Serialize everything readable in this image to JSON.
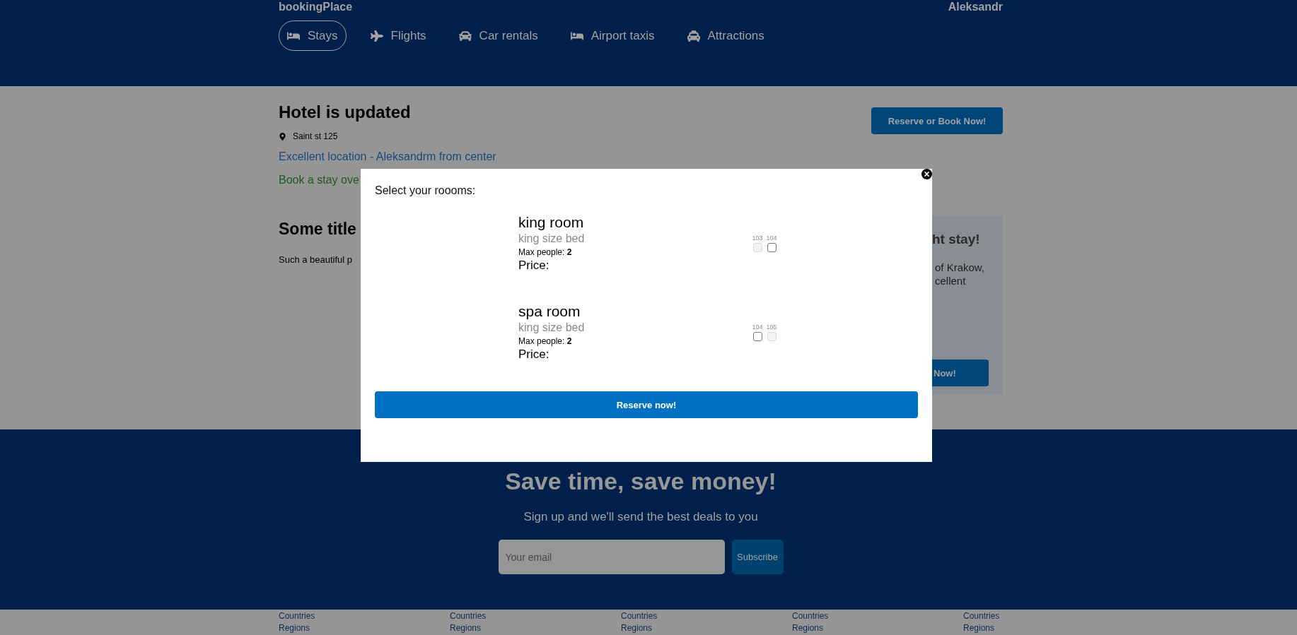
{
  "header": {
    "logo": "bookingPlace",
    "user": "Aleksandr"
  },
  "nav": [
    {
      "label": "Stays",
      "selected": true
    },
    {
      "label": "Flights",
      "selected": false
    },
    {
      "label": "Car rentals",
      "selected": false
    },
    {
      "label": "Airport taxis",
      "selected": false
    },
    {
      "label": "Attractions",
      "selected": false
    }
  ],
  "hotel": {
    "title": "Hotel is updated",
    "address": "Saint st 125",
    "distance": "Excellent location - Aleksandrm from center",
    "offer": "Book a stay ove",
    "reserve_button": "Reserve or Book Now!"
  },
  "details": {
    "title": "Some title",
    "text": "Such a beautiful p"
  },
  "side_panel": {
    "title": "ht stay!",
    "lines": [
      "of Krakow,",
      "cellent"
    ],
    "button": "Now!"
  },
  "modal": {
    "title": "Select your roooms:",
    "rooms": [
      {
        "name": "king room",
        "description": "king size bed",
        "max_people": "Max people: **2**",
        "price": "Price:",
        "numbers": [
          {
            "number": "103",
            "disabled": true,
            "checked": false
          },
          {
            "number": "104",
            "disabled": false,
            "checked": false
          }
        ]
      },
      {
        "name": "spa room",
        "description": "king size bed",
        "max_people": "Max people: **2**",
        "price": "Price:",
        "numbers": [
          {
            "number": "104",
            "disabled": false,
            "checked": false
          },
          {
            "number": "105",
            "disabled": true,
            "checked": false
          }
        ]
      }
    ],
    "button": "Reserve now!"
  },
  "newsletter": {
    "title": "Save time, save money!",
    "subtitle": "Sign up and we'll send the best deals to you",
    "email": {
      "placeholder": "Your email"
    },
    "button": "Subscribe"
  },
  "footer_columns": [
    {
      "items": [
        "Countries",
        "Regions"
      ]
    },
    {
      "items": [
        "Countries",
        "Regions"
      ]
    },
    {
      "items": [
        "Countries",
        "Regions"
      ]
    },
    {
      "items": [
        "Countries",
        "Regions"
      ]
    },
    {
      "items": [
        "Countries",
        "Regions"
      ]
    }
  ]
}
